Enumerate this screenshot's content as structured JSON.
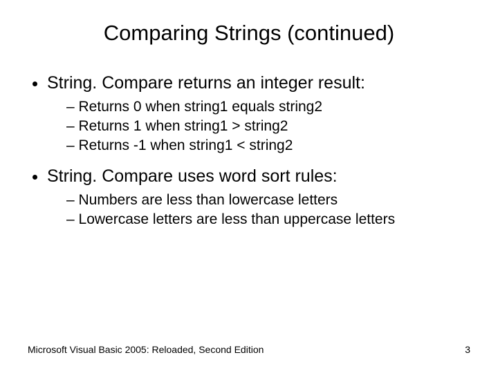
{
  "title": "Comparing Strings (continued)",
  "bullets": [
    {
      "text": "String. Compare returns an integer result:",
      "sub": [
        "Returns 0 when string1 equals string2",
        "Returns 1 when string1 > string2",
        "Returns -1 when string1 < string2"
      ]
    },
    {
      "text": "String. Compare uses word sort rules:",
      "sub": [
        "Numbers are less than lowercase letters",
        "Lowercase letters are less than uppercase letters"
      ]
    }
  ],
  "footer": {
    "left": "Microsoft Visual Basic 2005: Reloaded, Second Edition",
    "right": "3"
  }
}
